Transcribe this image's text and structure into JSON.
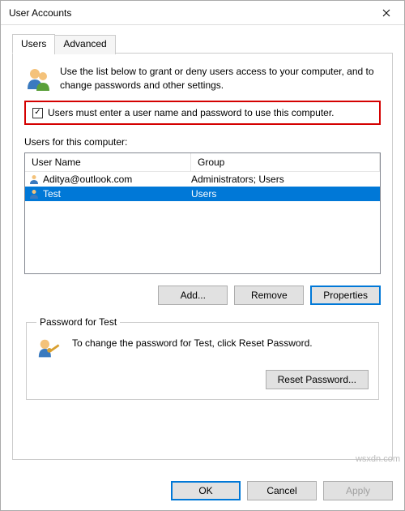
{
  "window": {
    "title": "User Accounts"
  },
  "tabs": {
    "users": "Users",
    "advanced": "Advanced"
  },
  "intro": "Use the list below to grant or deny users access to your computer, and to change passwords and other settings.",
  "checkbox": {
    "checked": "✓",
    "label": "Users must enter a user name and password to use this computer."
  },
  "users_group": {
    "label": "Users for this computer:",
    "columns": {
      "name": "User Name",
      "group": "Group"
    },
    "rows": [
      {
        "name": "Aditya@outlook.com",
        "group": "Administrators; Users",
        "selected": false
      },
      {
        "name": "Test",
        "group": "Users",
        "selected": true
      }
    ]
  },
  "buttons": {
    "add": "Add...",
    "remove": "Remove",
    "properties": "Properties"
  },
  "password_group": {
    "legend": "Password for Test",
    "text": "To change the password for Test, click Reset Password.",
    "reset": "Reset Password..."
  },
  "footer": {
    "ok": "OK",
    "cancel": "Cancel",
    "apply": "Apply"
  },
  "watermark": "wsxdn.com"
}
